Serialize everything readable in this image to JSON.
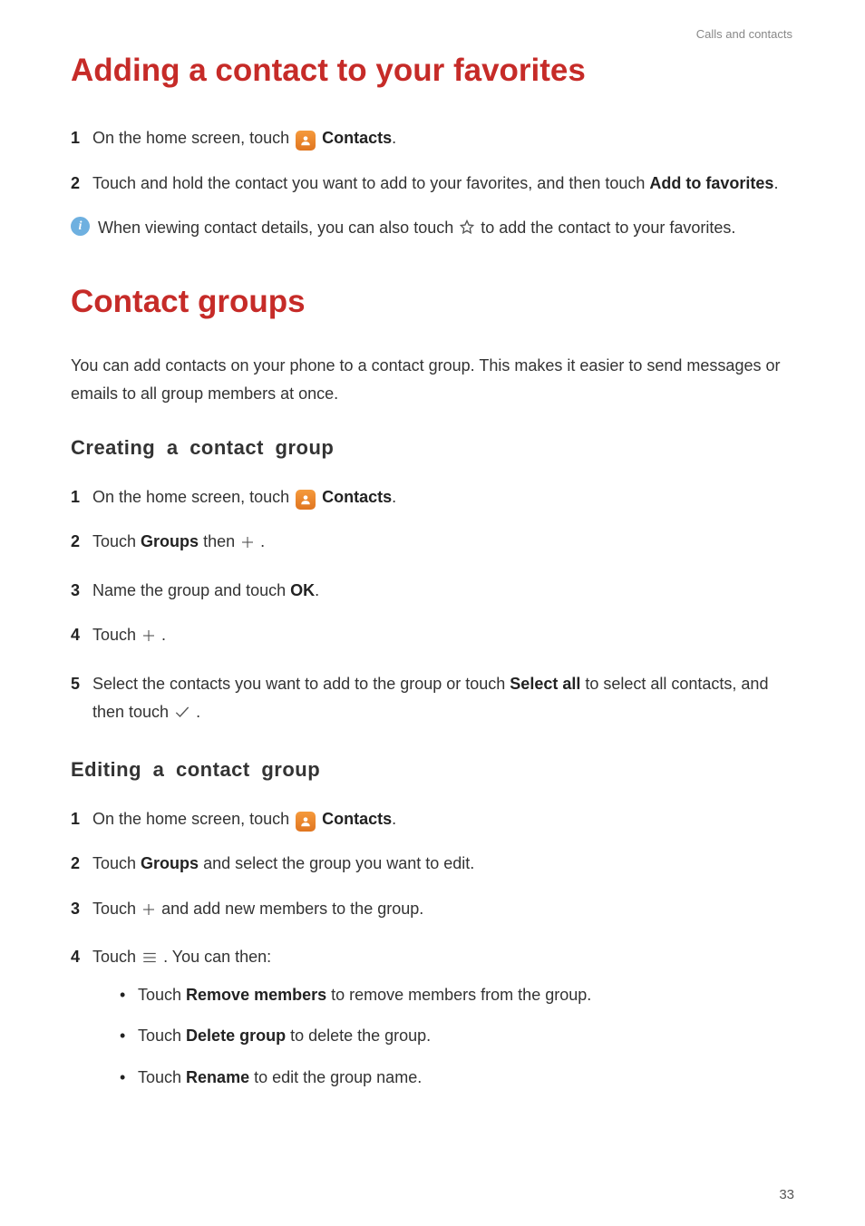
{
  "header": {
    "breadcrumb": "Calls and contacts"
  },
  "section1": {
    "title": "Adding a contact to your favorites",
    "step1_a": "On the home screen, touch ",
    "step1_b": "Contacts",
    "step1_c": ".",
    "step2_a": "Touch and hold the contact you want to add to your favorites, and then touch ",
    "step2_b": "Add to favorites",
    "step2_c": ".",
    "info_a": "When viewing contact details, you can also touch ",
    "info_b": " to add the contact to your favorites."
  },
  "section2": {
    "title": "Contact groups",
    "intro": "You can add contacts on your phone to a contact group. This makes it easier to send messages or emails to all group members at once."
  },
  "creating": {
    "title": "Creating a contact group",
    "step1_a": "On the home screen, touch ",
    "step1_b": "Contacts",
    "step1_c": ".",
    "step2_a": "Touch ",
    "step2_b": "Groups",
    "step2_c": " then ",
    "step2_d": " .",
    "step3_a": "Name the group and touch ",
    "step3_b": "OK",
    "step3_c": ".",
    "step4_a": "Touch ",
    "step4_b": " .",
    "step5_a": "Select the contacts you want to add to the group or touch ",
    "step5_b": "Select all",
    "step5_c": " to select all contacts, and then touch ",
    "step5_d": " ."
  },
  "editing": {
    "title": "Editing a contact group",
    "step1_a": "On the home screen, touch ",
    "step1_b": "Contacts",
    "step1_c": ".",
    "step2_a": "Touch ",
    "step2_b": "Groups",
    "step2_c": " and select the group you want to edit.",
    "step3_a": "Touch ",
    "step3_b": " and add new members to the group.",
    "step4_a": "Touch ",
    "step4_b": " . You can then:",
    "b1_a": "Touch ",
    "b1_b": "Remove members",
    "b1_c": " to remove members from the group.",
    "b2_a": "Touch ",
    "b2_b": "Delete group",
    "b2_c": " to delete the group.",
    "b3_a": "Touch ",
    "b3_b": "Rename",
    "b3_c": " to edit the group name."
  },
  "page_number": "33",
  "icons": {
    "contacts": "contacts-app-icon",
    "star": "star-outline-icon",
    "plus": "plus-icon",
    "check": "check-icon",
    "menu": "menu-icon",
    "info": "info-icon"
  }
}
